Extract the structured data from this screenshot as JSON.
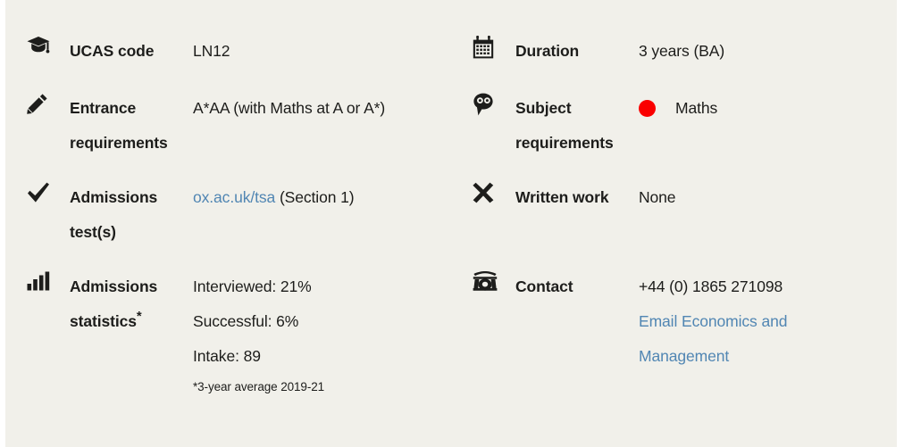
{
  "theme": {
    "background": "#f1f0ea",
    "page_background": "#ffffff",
    "text": "#1d1d1b",
    "link": "#5186b3",
    "accent_red": "#fa0000"
  },
  "left_column": [
    {
      "icon": "graduation-cap-icon",
      "label": "UCAS code",
      "value": "LN12"
    },
    {
      "icon": "pencil-icon",
      "label_line1": "Entrance",
      "label_line2": "requirements",
      "value": "A*AA (with Maths at A or A*)"
    },
    {
      "icon": "checkmark-icon",
      "label_line1": "Admissions",
      "label_line2": "test(s)",
      "value_link": "ox.ac.uk/tsa",
      "value_suffix": " (Section 1)"
    },
    {
      "icon": "bar-chart-icon",
      "label_line1": "Admissions",
      "label_line2": "statistics",
      "label_marker": "*",
      "stats": [
        "Interviewed: 21%",
        "Successful: 6%",
        "Intake: 89"
      ],
      "footnote": "*3-year average 2019-21"
    }
  ],
  "right_column": [
    {
      "icon": "calendar-icon",
      "label": "Duration",
      "value": "3 years (BA)"
    },
    {
      "icon": "head-brain-icon",
      "label_line1": "Subject",
      "label_line2": "requirements",
      "bullet_color": "#fa0000",
      "value": "Maths"
    },
    {
      "icon": "cross-x-icon",
      "label": "Written work",
      "value": "None"
    },
    {
      "icon": "telephone-icon",
      "label": "Contact",
      "phone": "+44 (0) 1865 271098",
      "email_link_line1": "Email Economics and",
      "email_link_line2": "Management"
    }
  ]
}
